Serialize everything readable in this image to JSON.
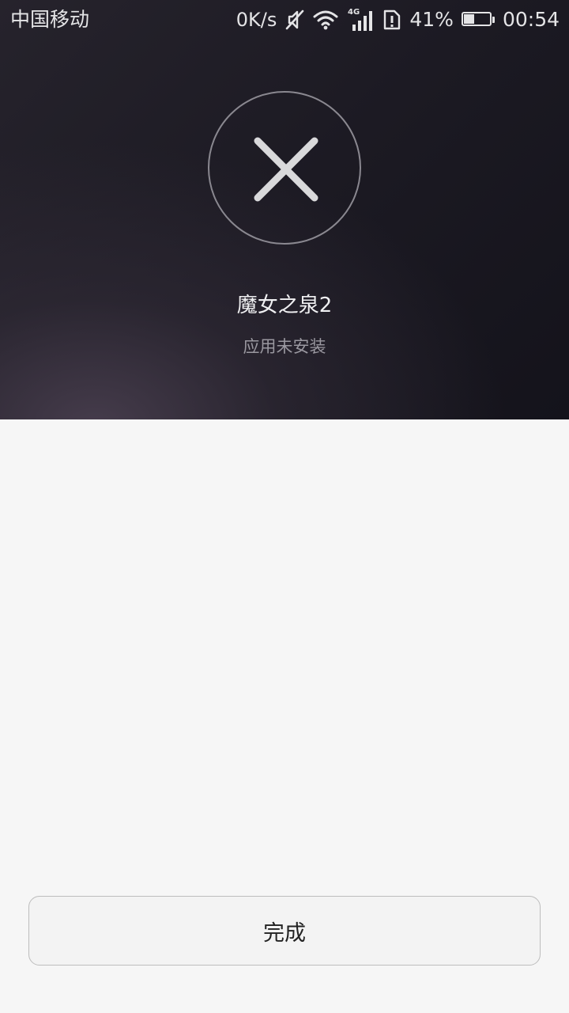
{
  "status_bar": {
    "carrier": "中国移动",
    "net_speed": "0K/s",
    "network_type": "4G",
    "battery_percent": "41%",
    "battery_level": 0.41,
    "time": "00:54",
    "icons": [
      "mute-icon",
      "wifi-icon",
      "signal-icon",
      "sim-alert-icon",
      "battery-icon"
    ]
  },
  "result": {
    "icon": "close-icon",
    "app_name": "魔女之泉2",
    "status": "应用未安装"
  },
  "actions": {
    "done_label": "完成"
  },
  "colors": {
    "header_bg": "#1c1a23",
    "page_bg": "#f6f6f6",
    "button_bg": "#f3f3f3"
  }
}
